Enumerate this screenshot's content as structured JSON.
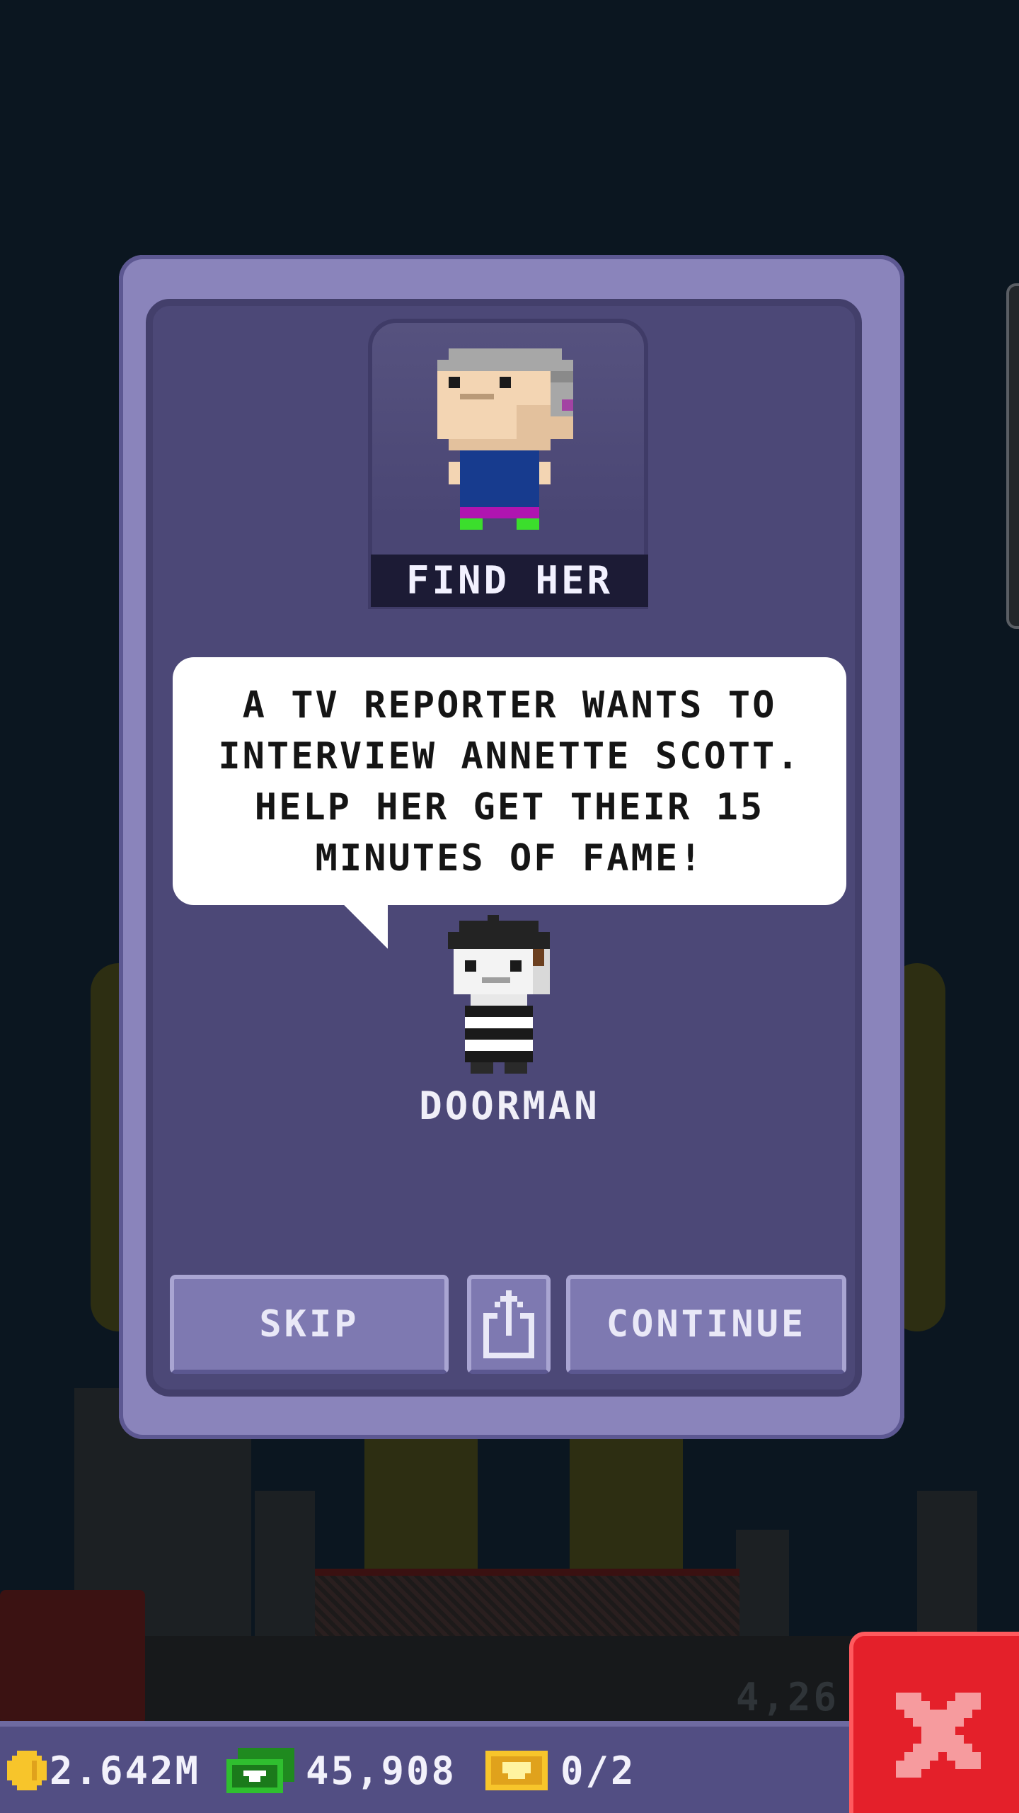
{
  "quest": {
    "header_label": "FIND HER",
    "message": "A TV REPORTER WANTS TO INTERVIEW ANNETTE SCOTT. HELP HER GET THEIR 15 MINUTES OF FAME!",
    "speaker_name": "DOORMAN"
  },
  "buttons": {
    "skip": "SKIP",
    "continue": "CONTINUE"
  },
  "hud": {
    "coins": "2.642M",
    "bux": "45,908",
    "tickets": "0/2"
  },
  "background": {
    "floor_number": "4,26"
  },
  "colors": {
    "panel": "#8a84bb",
    "panel_inner": "#4c4877",
    "close_button": "#e4202a",
    "background": "#0b1620"
  },
  "icons": {
    "share": "share-icon",
    "close": "close-x-icon",
    "coin": "coin-icon",
    "bux": "bux-bill-icon",
    "ticket": "vip-ticket-icon"
  }
}
